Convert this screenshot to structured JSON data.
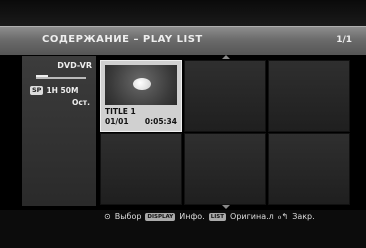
{
  "header": {
    "title": "СОДЕРЖАНИЕ – PLAY LIST",
    "page": "1/1"
  },
  "disc": {
    "type": "DVD-VR",
    "mode_badge": "SP",
    "remaining_time": "1H 50M",
    "remaining_label": "Ост."
  },
  "titles": [
    {
      "name": "TITLE 1",
      "index": "01/01",
      "duration": "0:05:34"
    }
  ],
  "help": {
    "select_icon": "⊙",
    "select_label": "Выбор",
    "display_key": "DISPLAY",
    "info_label": "Инфо.",
    "list_key": "LIST",
    "original_label": "Оригина.л",
    "return_icon": "ℴ↰",
    "close_label": "Закр."
  }
}
